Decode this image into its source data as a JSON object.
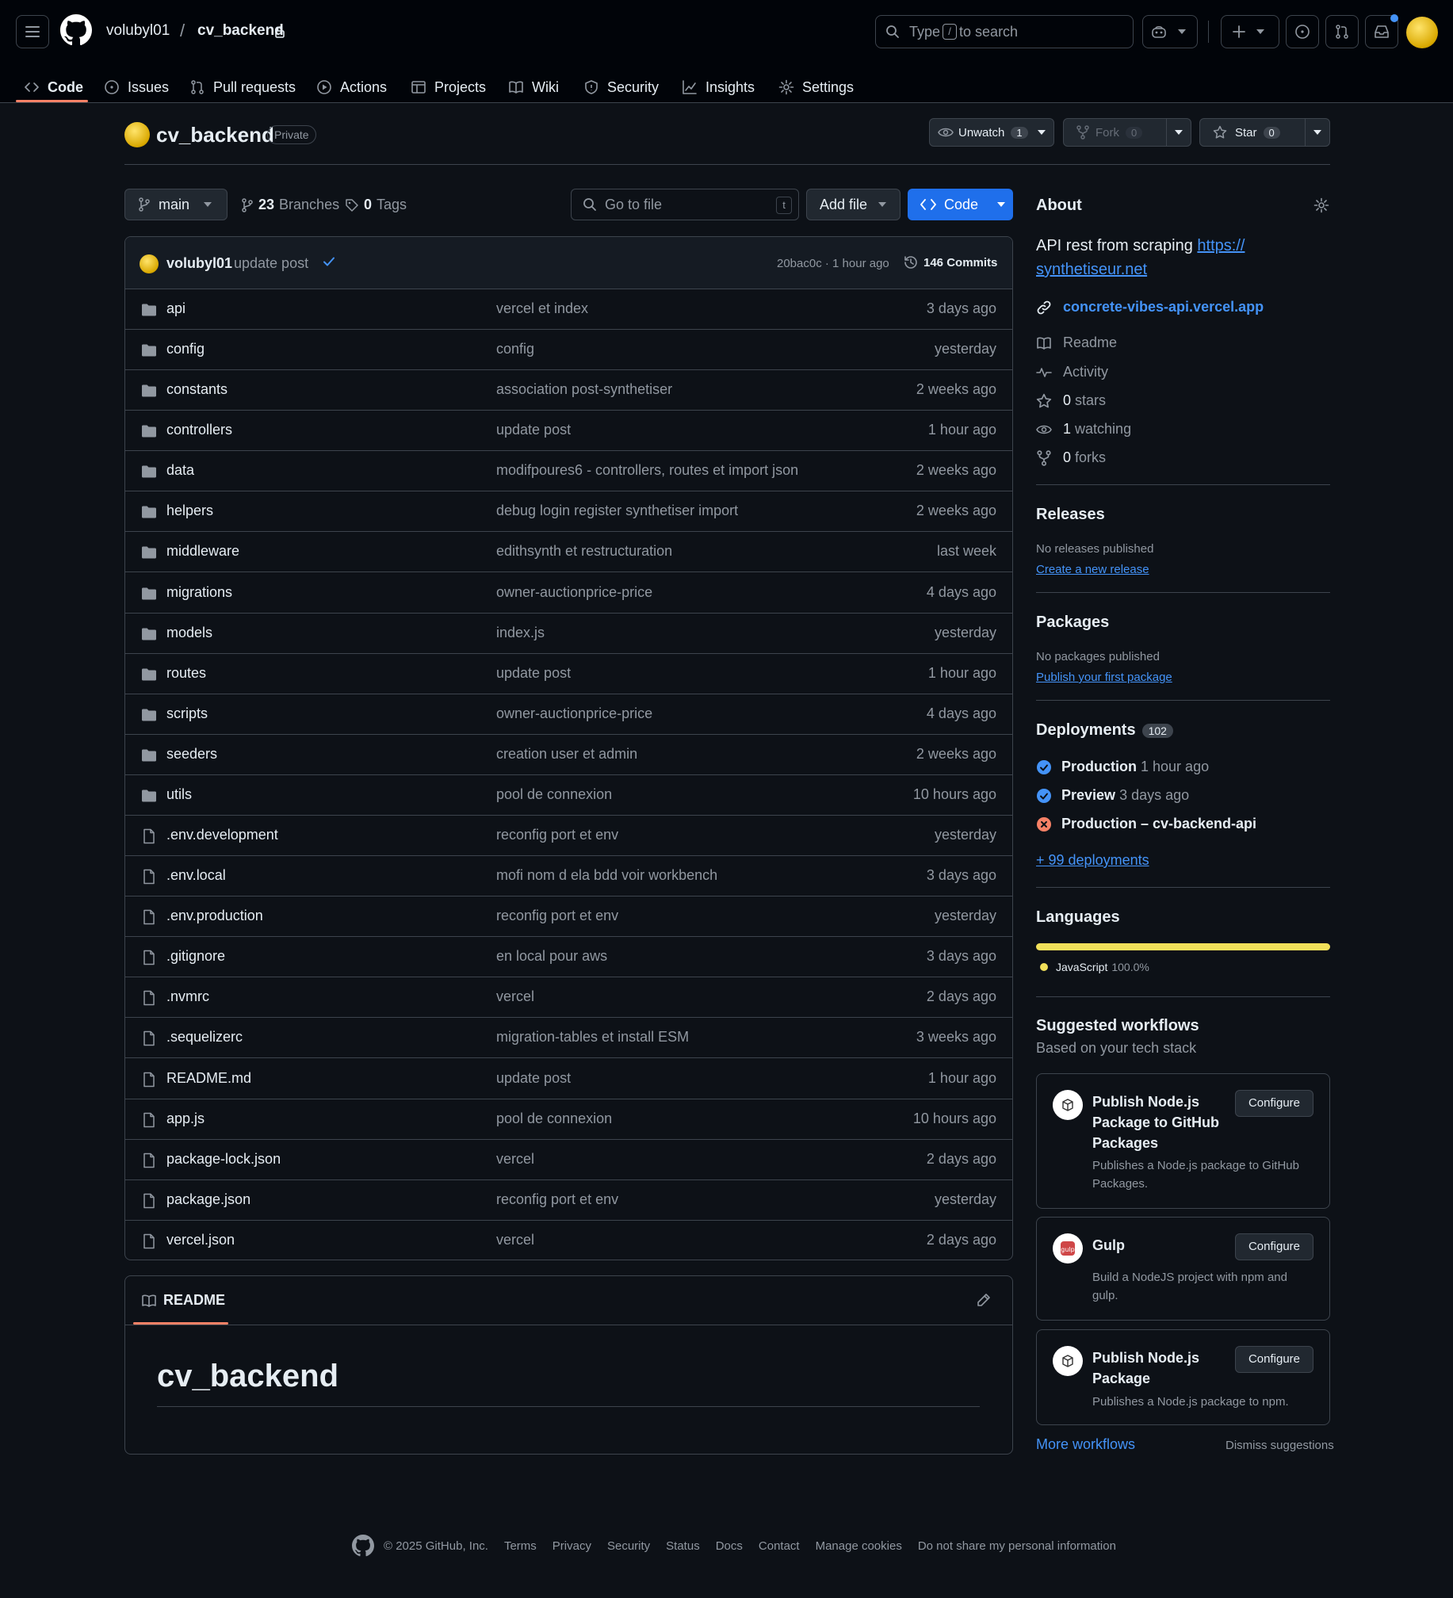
{
  "header": {
    "owner": "volubyl01",
    "separator": "/",
    "repo": "cv_backend",
    "search_before": "Type",
    "search_key": "/",
    "search_after": "to search"
  },
  "tabs": [
    {
      "label": "Code",
      "icon": "code-icon"
    },
    {
      "label": "Issues",
      "icon": "issue-icon"
    },
    {
      "label": "Pull requests",
      "icon": "pull-request-icon"
    },
    {
      "label": "Actions",
      "icon": "play-icon"
    },
    {
      "label": "Projects",
      "icon": "table-icon"
    },
    {
      "label": "Wiki",
      "icon": "book-icon"
    },
    {
      "label": "Security",
      "icon": "shield-icon"
    },
    {
      "label": "Insights",
      "icon": "graph-icon"
    },
    {
      "label": "Settings",
      "icon": "gear-icon"
    }
  ],
  "repo": {
    "name": "cv_backend",
    "visibility": "Private",
    "unwatch_label": "Unwatch",
    "watch_count": "1",
    "fork_label": "Fork",
    "fork_count": "0",
    "star_label": "Star",
    "star_count": "0"
  },
  "branchbar": {
    "branch": "main",
    "branches_count": "23",
    "branches_label": "Branches",
    "tags_count": "0",
    "tags_label": "Tags",
    "goto_placeholder": "Go to file",
    "goto_key": "t",
    "add_file": "Add file",
    "code": "Code"
  },
  "latest_commit": {
    "user": "volubyl01",
    "message": "update post",
    "meta": "20bac0c · 1 hour ago",
    "commits": "146 Commits"
  },
  "files": [
    {
      "type": "dir",
      "name": "api",
      "message": "vercel et index",
      "age": "3 days ago"
    },
    {
      "type": "dir",
      "name": "config",
      "message": "config",
      "age": "yesterday"
    },
    {
      "type": "dir",
      "name": "constants",
      "message": "association post-synthetiser",
      "age": "2 weeks ago"
    },
    {
      "type": "dir",
      "name": "controllers",
      "message": "update post",
      "age": "1 hour ago"
    },
    {
      "type": "dir",
      "name": "data",
      "message": "modifpoures6 - controllers, routes et import json",
      "age": "2 weeks ago"
    },
    {
      "type": "dir",
      "name": "helpers",
      "message": "debug login register synthetiser import",
      "age": "2 weeks ago"
    },
    {
      "type": "dir",
      "name": "middleware",
      "message": "edithsynth et restructuration",
      "age": "last week"
    },
    {
      "type": "dir",
      "name": "migrations",
      "message": "owner-auctionprice-price",
      "age": "4 days ago"
    },
    {
      "type": "dir",
      "name": "models",
      "message": "index.js",
      "age": "yesterday"
    },
    {
      "type": "dir",
      "name": "routes",
      "message": "update post",
      "age": "1 hour ago"
    },
    {
      "type": "dir",
      "name": "scripts",
      "message": "owner-auctionprice-price",
      "age": "4 days ago"
    },
    {
      "type": "dir",
      "name": "seeders",
      "message": "creation user et admin",
      "age": "2 weeks ago"
    },
    {
      "type": "dir",
      "name": "utils",
      "message": "pool de connexion",
      "age": "10 hours ago"
    },
    {
      "type": "file",
      "name": ".env.development",
      "message": "reconfig port et env",
      "age": "yesterday"
    },
    {
      "type": "file",
      "name": ".env.local",
      "message": "mofi nom d ela bdd voir workbench",
      "age": "3 days ago"
    },
    {
      "type": "file",
      "name": ".env.production",
      "message": "reconfig port et env",
      "age": "yesterday"
    },
    {
      "type": "file",
      "name": ".gitignore",
      "message": "en local pour aws",
      "age": "3 days ago"
    },
    {
      "type": "file",
      "name": ".nvmrc",
      "message": "vercel",
      "age": "2 days ago"
    },
    {
      "type": "file",
      "name": ".sequelizerc",
      "message": "migration-tables et install ESM",
      "age": "3 weeks ago"
    },
    {
      "type": "file",
      "name": "README.md",
      "message": "update post",
      "age": "1 hour ago"
    },
    {
      "type": "file",
      "name": "app.js",
      "message": "pool de connexion",
      "age": "10 hours ago"
    },
    {
      "type": "file",
      "name": "package-lock.json",
      "message": "vercel",
      "age": "2 days ago"
    },
    {
      "type": "file",
      "name": "package.json",
      "message": "reconfig port et env",
      "age": "yesterday"
    },
    {
      "type": "file",
      "name": "vercel.json",
      "message": "vercel",
      "age": "2 days ago"
    }
  ],
  "readme": {
    "tab": "README",
    "heading": "cv_backend"
  },
  "about": {
    "title": "About",
    "desc_text": "API rest from scraping",
    "desc_link_1": "https://",
    "desc_link_2": "synthetiseur.net",
    "website": "concrete-vibes-api.vercel.app",
    "readme": "Readme",
    "activity": "Activity",
    "stars_count": "0",
    "stars_label": "stars",
    "watching_count": "1",
    "watching_label": "watching",
    "forks_count": "0",
    "forks_label": "forks"
  },
  "releases": {
    "title": "Releases",
    "none": "No releases published",
    "link": "Create a new release"
  },
  "packages": {
    "title": "Packages",
    "none": "No packages published",
    "link": "Publish your first package"
  },
  "deployments": {
    "title": "Deployments",
    "count": "102",
    "items": [
      {
        "env": "Production",
        "time": "1 hour ago",
        "status": "success"
      },
      {
        "env": "Preview",
        "time": "3 days ago",
        "status": "success"
      },
      {
        "env": "Production – cv-backend-api",
        "time": "",
        "status": "failure"
      }
    ],
    "more": "+ 99 deployments"
  },
  "languages": {
    "title": "Languages",
    "items": [
      {
        "name": "JavaScript",
        "percent": "100.0%",
        "fraction": 1.0,
        "color": "#f1e05a"
      }
    ]
  },
  "workflows": {
    "title": "Suggested workflows",
    "subtitle": "Based on your tech stack",
    "items": [
      {
        "title": "Publish Node.js Package to GitHub Packages",
        "desc": "Publishes a Node.js package to GitHub Packages.",
        "button": "Configure"
      },
      {
        "title": "Gulp",
        "desc": "Build a NodeJS project with npm and gulp.",
        "button": "Configure"
      },
      {
        "title": "Publish Node.js Package",
        "desc": "Publishes a Node.js package to npm.",
        "button": "Configure"
      }
    ],
    "more": "More workflows",
    "dismiss": "Dismiss suggestions"
  },
  "footer": {
    "copyright": "© 2025 GitHub, Inc.",
    "links": [
      "Terms",
      "Privacy",
      "Security",
      "Status",
      "Docs",
      "Contact",
      "Manage cookies",
      "Do not share my personal information"
    ]
  },
  "colors": {
    "accent": "#1f6feb",
    "tab_underline": "#f78166",
    "success": "#4493f8",
    "failure": "#f78166"
  }
}
